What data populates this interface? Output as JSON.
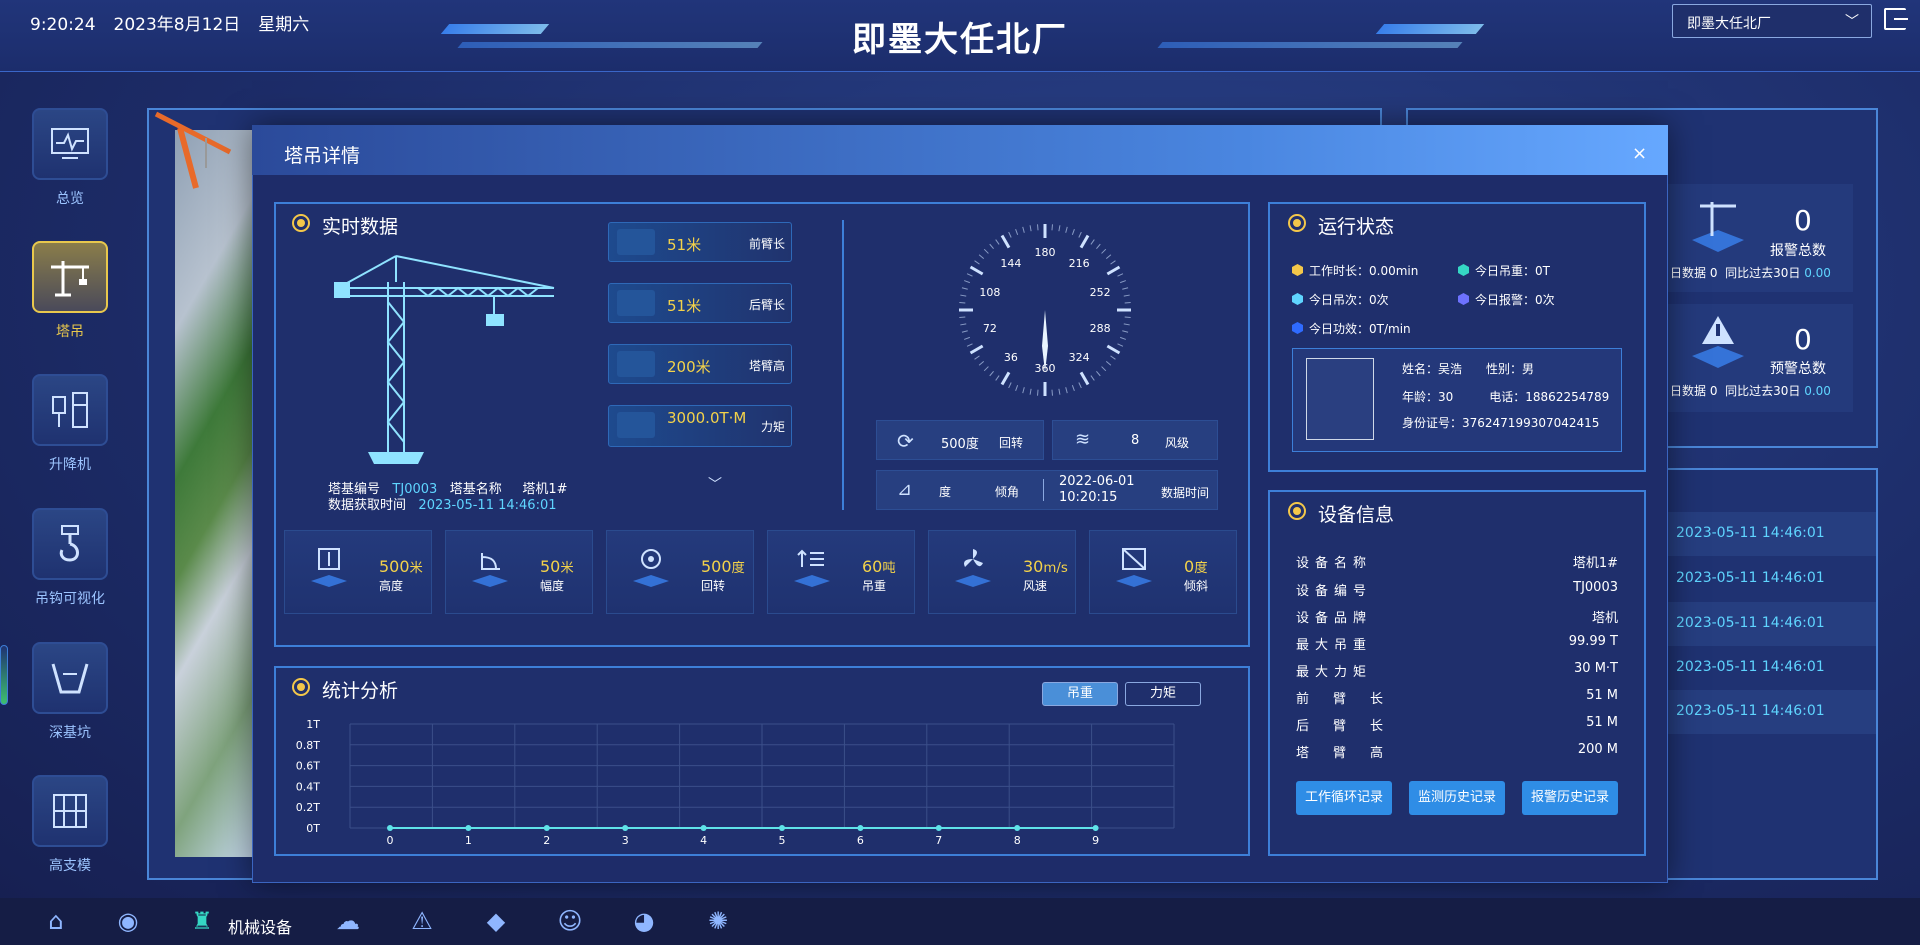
{
  "header": {
    "time": "9:20:24",
    "date": "2023年8月12日",
    "weekday": "星期六",
    "title": "即墨大任北厂",
    "site_select": "即墨大任北厂"
  },
  "left_nav": [
    {
      "label": "总览",
      "icon": "monitor-icon"
    },
    {
      "label": "塔吊",
      "icon": "tower-crane-icon",
      "active": true
    },
    {
      "label": "升降机",
      "icon": "elevator-icon"
    },
    {
      "label": "吊钩可视化",
      "icon": "hook-icon"
    },
    {
      "label": "深基坑",
      "icon": "pit-icon"
    },
    {
      "label": "高支模",
      "icon": "formwork-icon"
    }
  ],
  "right_bg": {
    "alarm_total_value": "0",
    "alarm_total_label": "报警总数",
    "warn_total_value": "0",
    "warn_total_label": "预警总数",
    "alarm_note_left": "日数据 0",
    "alarm_note_right": "同比过去30日",
    "alarm_note_right_value": "0.00",
    "warn_note_left": "日数据 0",
    "warn_note_right": "同比过去30日",
    "warn_note_right_value": "0.00",
    "rows": [
      "2023-05-11 14:46:01",
      "2023-05-11 14:46:01",
      "2023-05-11 14:46:01",
      "2023-05-11 14:46:01",
      "2023-05-11 14:46:01"
    ]
  },
  "modal": {
    "title": "塔吊详情",
    "close": "×",
    "realtime": {
      "title": "实时数据",
      "tags": [
        {
          "value": "51米",
          "label": "前臂长"
        },
        {
          "value": "51米",
          "label": "后臂长"
        },
        {
          "value": "200米",
          "label": "塔臂高"
        },
        {
          "value": "3000.0T·M",
          "label": "力矩"
        }
      ],
      "base_no_label": "塔基编号",
      "base_no": "TJ0003",
      "base_name_label": "塔基名称",
      "base_name": "塔机1#",
      "fetch_time_label": "数据获取时间",
      "fetch_time": "2023-05-11 14:46:01",
      "compass_ticks": [
        "180",
        "216",
        "252",
        "288",
        "324",
        "360",
        "36",
        "72",
        "108",
        "144"
      ],
      "rotation": {
        "value": "500度",
        "label": "回转"
      },
      "wind": {
        "value": "8",
        "label": "风级"
      },
      "tilt": {
        "value": "度",
        "label": "倾角"
      },
      "data_time": {
        "value": "2022-06-01 10:20:15",
        "label": "数据时间"
      },
      "metrics": [
        {
          "value": "500",
          "unit": "米",
          "label": "高度"
        },
        {
          "value": "50",
          "unit": "米",
          "label": "幅度"
        },
        {
          "value": "500",
          "unit": "度",
          "label": "回转"
        },
        {
          "value": "60",
          "unit": "吨",
          "label": "吊重"
        },
        {
          "value": "30",
          "unit": "m/s",
          "label": "风速"
        },
        {
          "value": "0",
          "unit": "度",
          "label": "倾斜"
        }
      ]
    },
    "stats": {
      "title": "统计分析",
      "toggle_load": "吊重",
      "toggle_torque": "力矩"
    },
    "status": {
      "title": "运行状态",
      "work_hours": "工作时长：0.00min",
      "today_load": "今日吊重：0T",
      "today_lifts": "今日吊次：0次",
      "today_alarms": "今日报警：0次",
      "today_efficiency": "今日功效：0T/min",
      "operator": {
        "name": "姓名：吴浩",
        "gender": "性别：男",
        "age": "年龄：30",
        "phone": "电话：18862254789",
        "id_card": "身份证号：376247199307042415"
      }
    },
    "device": {
      "title": "设备信息",
      "rows": [
        {
          "k": "设备名称",
          "v": "塔机1#"
        },
        {
          "k": "设备编号",
          "v": "TJ0003"
        },
        {
          "k": "设备品牌",
          "v": "塔机"
        },
        {
          "k": "最大吊重",
          "v": "99.99 T"
        },
        {
          "k": "最大力矩",
          "v": "30 M·T"
        },
        {
          "k": "前臂长",
          "v": "51 M"
        },
        {
          "k": "后臂长",
          "v": "51 M"
        },
        {
          "k": "塔臂高",
          "v": "200 M"
        }
      ],
      "buttons": [
        "工作循环记录",
        "监测历史记录",
        "报警历史记录"
      ]
    }
  },
  "chart_data": {
    "type": "line",
    "x": [
      0,
      1,
      2,
      3,
      4,
      5,
      6,
      7,
      8,
      9
    ],
    "y_ticks": [
      "1T",
      "0.8T",
      "0.6T",
      "0.4T",
      "0.2T",
      "0T"
    ],
    "series": [
      {
        "values": [
          0,
          0,
          0,
          0,
          0,
          0,
          0,
          0,
          0,
          0
        ]
      }
    ],
    "ylim": [
      0,
      1
    ],
    "grid": true
  },
  "bottom_bar": {
    "active_label": "机械设备",
    "icons": [
      "home-icon",
      "camera-icon",
      "machinery-icon",
      "weather-icon",
      "warning-icon",
      "quality-icon",
      "people-icon",
      "pie-chart-icon",
      "alarm-light-icon"
    ]
  },
  "colors": {
    "accent": "#f3d24a",
    "cyan": "#5fd5ff",
    "button": "#2f8de6"
  }
}
